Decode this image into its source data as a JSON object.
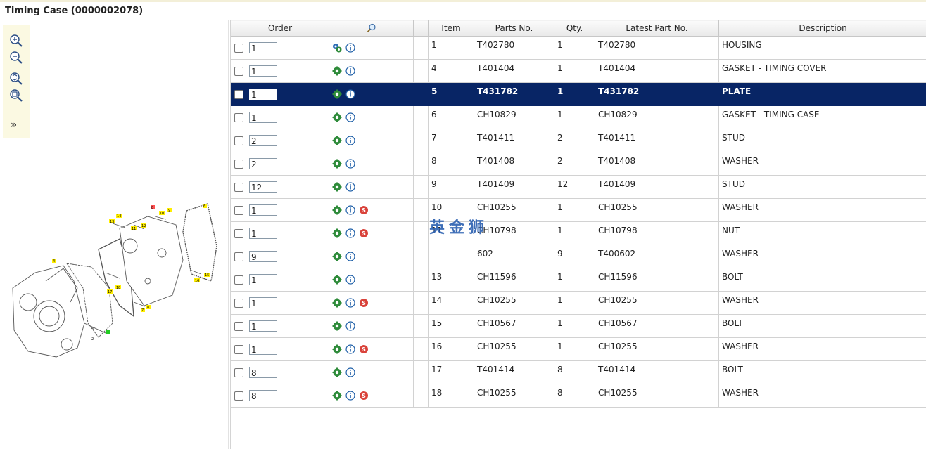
{
  "title": "Timing Case (0000002078)",
  "toolbar": {
    "items": [
      "zoom-in-icon",
      "zoom-out-icon",
      "zoom-fit-icon",
      "zoom-window-icon"
    ],
    "expand_label": "»"
  },
  "diagram_labels": [
    "14",
    "13",
    "9",
    "10",
    "11",
    "12",
    "6",
    "8",
    "4",
    "17",
    "18",
    "7",
    "8",
    "3",
    "2",
    "16",
    "15"
  ],
  "table": {
    "headers": {
      "order": "Order",
      "search_icon": "search-icon",
      "item": "Item",
      "parts_no": "Parts No.",
      "qty": "Qty.",
      "latest": "Latest Part No.",
      "description": "Description"
    },
    "rows": [
      {
        "order_qty": "1",
        "item": "1",
        "parts_no": "T402780",
        "qty": "1",
        "latest": "T402780",
        "description": "HOUSING"
      },
      {
        "order_qty": "1",
        "item": "4",
        "parts_no": "T401404",
        "qty": "1",
        "latest": "T401404",
        "description": "GASKET - TIMING COVER"
      },
      {
        "order_qty": "1",
        "item": "5",
        "parts_no": "T431782",
        "qty": "1",
        "latest": "T431782",
        "description": "PLATE"
      },
      {
        "order_qty": "1",
        "item": "6",
        "parts_no": "CH10829",
        "qty": "1",
        "latest": "CH10829",
        "description": "GASKET - TIMING CASE"
      },
      {
        "order_qty": "2",
        "item": "7",
        "parts_no": "T401411",
        "qty": "2",
        "latest": "T401411",
        "description": "STUD"
      },
      {
        "order_qty": "2",
        "item": "8",
        "parts_no": "T401408",
        "qty": "2",
        "latest": "T401408",
        "description": "WASHER"
      },
      {
        "order_qty": "12",
        "item": "9",
        "parts_no": "T401409",
        "qty": "12",
        "latest": "T401409",
        "description": "STUD"
      },
      {
        "order_qty": "1",
        "item": "10",
        "parts_no": "CH10255",
        "qty": "1",
        "latest": "CH10255",
        "description": "WASHER"
      },
      {
        "order_qty": "1",
        "item": "11",
        "parts_no": "CH10798",
        "qty": "1",
        "latest": "CH10798",
        "description": "NUT"
      },
      {
        "order_qty": "9",
        "item": "",
        "parts_no": "602",
        "qty": "9",
        "latest": "T400602",
        "description": "WASHER"
      },
      {
        "order_qty": "1",
        "item": "13",
        "parts_no": "CH11596",
        "qty": "1",
        "latest": "CH11596",
        "description": "BOLT"
      },
      {
        "order_qty": "1",
        "item": "14",
        "parts_no": "CH10255",
        "qty": "1",
        "latest": "CH10255",
        "description": "WASHER"
      },
      {
        "order_qty": "1",
        "item": "15",
        "parts_no": "CH10567",
        "qty": "1",
        "latest": "CH10567",
        "description": "BOLT"
      },
      {
        "order_qty": "1",
        "item": "16",
        "parts_no": "CH10255",
        "qty": "1",
        "latest": "CH10255",
        "description": "WASHER"
      },
      {
        "order_qty": "8",
        "item": "17",
        "parts_no": "T401414",
        "qty": "8",
        "latest": "T401414",
        "description": "BOLT"
      },
      {
        "order_qty": "8",
        "item": "18",
        "parts_no": "CH10255",
        "qty": "8",
        "latest": "CH10255",
        "description": "WASHER"
      }
    ]
  },
  "watermark": "英金狮",
  "colors": {
    "selected_row": "#082565",
    "header_bg": "#ececec",
    "toolbar_bg": "#fbf9e2",
    "gear_green": "#2e8b3a",
    "info_blue": "#1f5fa8",
    "s_red": "#d9423a"
  }
}
